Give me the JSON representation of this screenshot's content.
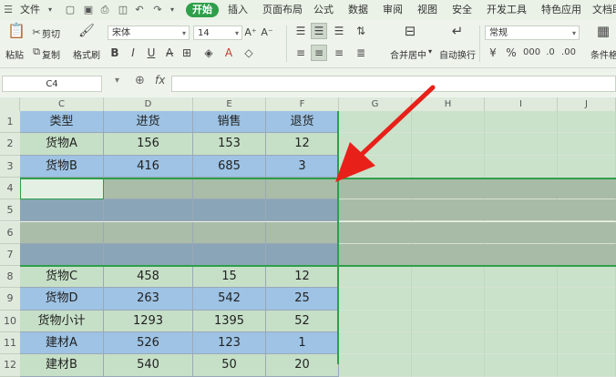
{
  "menubar": {
    "file_label": "文件",
    "tabs": [
      "开始",
      "插入",
      "页面布局",
      "公式",
      "数据",
      "审阅",
      "视图",
      "安全",
      "开发工具",
      "特色应用",
      "文档助"
    ],
    "active_tab": "开始"
  },
  "ribbon": {
    "paste": "粘贴",
    "cut": "剪切",
    "copy": "复制",
    "format_painter": "格式刷",
    "font_name": "宋体",
    "font_size": "14",
    "bold": "B",
    "italic": "I",
    "underline": "U",
    "merge_center": "合并居中",
    "wrap_text": "自动换行",
    "number_format": "常规",
    "conditional_format": "条件格式"
  },
  "formula": {
    "name_box": "C4",
    "fx_label": "fx",
    "value": ""
  },
  "columns": [
    "C",
    "D",
    "E",
    "F",
    "G",
    "H",
    "I",
    "J"
  ],
  "rows": [
    "1",
    "2",
    "3",
    "4",
    "5",
    "6",
    "7",
    "8",
    "9",
    "10",
    "11",
    "12"
  ],
  "table": {
    "header": [
      "类型",
      "进货",
      "销售",
      "退货"
    ],
    "rows": [
      [
        "货物A",
        "156",
        "153",
        "12"
      ],
      [
        "货物B",
        "416",
        "685",
        "3"
      ],
      [
        "",
        "",
        "",
        ""
      ],
      [
        "",
        "",
        "",
        ""
      ],
      [
        "",
        "",
        "",
        ""
      ],
      [
        "",
        "",
        "",
        ""
      ],
      [
        "货物C",
        "458",
        "15",
        "12"
      ],
      [
        "货物D",
        "263",
        "542",
        "25"
      ],
      [
        "货物小计",
        "1293",
        "1395",
        "52"
      ],
      [
        "建材A",
        "526",
        "123",
        "1"
      ],
      [
        "建材B",
        "540",
        "50",
        "20"
      ]
    ]
  },
  "colors": {
    "accent": "#2e9f4a",
    "header_blue": "#9ec3e4",
    "row_green": "#c6e0c7",
    "arrow": "#e8201a"
  }
}
